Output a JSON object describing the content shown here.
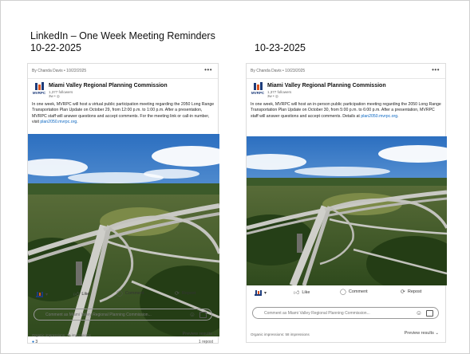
{
  "slide": {
    "title": "LinkedIn – One Week Meeting Reminders",
    "date_left": "10-22-2025",
    "date_right": "10-23-2025"
  },
  "posts": [
    {
      "byline": "By Chanda Davis • 10/22/2025",
      "more": "•••",
      "org_name": "Miami Valley Regional Planning Commission",
      "followers": "1,377 followers",
      "time": "3w • ",
      "logo_text": "MVRPC",
      "body_text": "In one week, MVRPC will host a virtual public participation meeting regarding the 2050 Long Range Transportation Plan Update on October 29, from 12:00 p.m. to 1:00 p.m. After a presentation, MVRPC staff will answer questions and accept comments. For the meeting link or call-in number, visit ",
      "body_link": "plan2050.mvrpc.org",
      "body_end": ".",
      "reaction_count": "3",
      "reposts": "1 repost",
      "like": "Like",
      "comment": "Comment",
      "repost": "Repost",
      "comment_placeholder": "Comment as Miami Valley Regional Planning Commission...",
      "impressions": "Organic impressions: 79 impressions",
      "preview": "Preview results"
    },
    {
      "byline": "By Chanda Davis • 10/23/2025",
      "more": "•••",
      "org_name": "Miami Valley Regional Planning Commission",
      "followers": "1,377 followers",
      "time": "3w • ",
      "logo_text": "MVRPC",
      "body_text": "In one week, MVRPC will host an in-person public participation meeting regarding the 2050 Long Range Transportation Plan Update on October 30, from 5:00 p.m. to 6:00 p.m. After a presentation, MVRPC staff will answer questions and accept comments. Details at ",
      "body_link": "plan2050.mvrpc.org",
      "body_end": ".",
      "like": "Like",
      "comment": "Comment",
      "repost": "Repost",
      "comment_placeholder": "Comment as Miami Valley Regional Planning Commission...",
      "impressions": "Organic impressions: 58 impressions",
      "preview": "Preview results"
    }
  ],
  "icons": {
    "like": "thumbs-up-icon",
    "comment": "comment-icon",
    "repost": "repost-icon",
    "emoji": "emoji-icon",
    "image": "image-icon",
    "globe": "globe-icon",
    "reaction": "reaction-like-icon",
    "chevron": "chevron-down-icon"
  },
  "colors": {
    "link": "#0a66c2",
    "brand_blue": "#1d3b7a",
    "brand_orange": "#d9531e"
  }
}
